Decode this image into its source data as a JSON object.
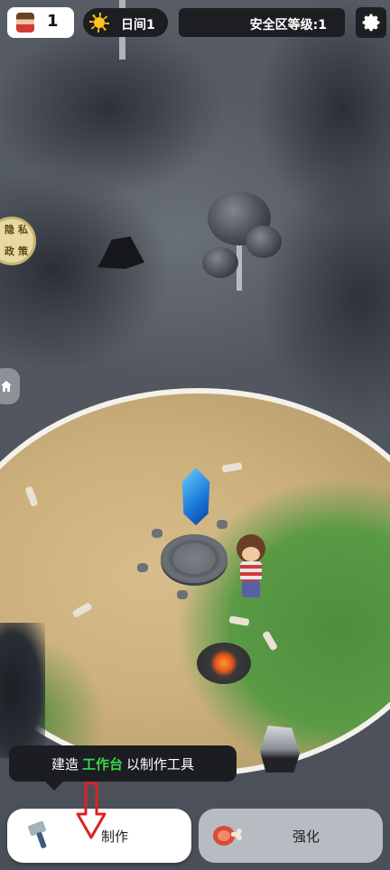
{
  "hud": {
    "player_count": "1",
    "day_label": "日间1",
    "safe_zone_label": "安全区等级:1"
  },
  "side": {
    "privacy_line1": "隐私",
    "privacy_line2": "政策"
  },
  "hint": {
    "prefix": "建造",
    "highlight": "工作台",
    "suffix": "以制作工具"
  },
  "buttons": {
    "craft": "制作",
    "upgrade": "强化"
  },
  "colors": {
    "hint_highlight": "#3cd64a",
    "arrow": "#e02020",
    "sun": "#ffc21a"
  }
}
